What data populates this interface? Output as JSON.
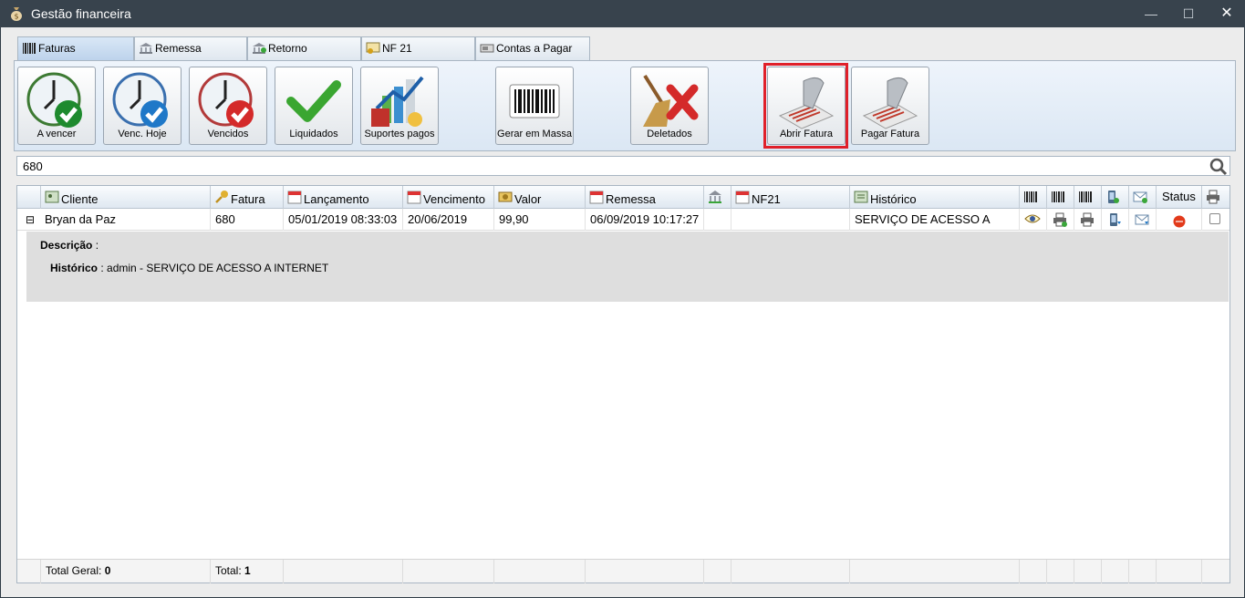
{
  "window": {
    "title": "Gestão financeira",
    "controls": {
      "minimize": "—",
      "maximize": "☐",
      "close": "✕"
    }
  },
  "tabs": [
    {
      "label": "Faturas",
      "icon": "barcode-icon",
      "active": true
    },
    {
      "label": "Remessa",
      "icon": "bank-icon"
    },
    {
      "label": "Retorno",
      "icon": "bank-return-icon"
    },
    {
      "label": "NF 21",
      "icon": "certificate-icon"
    },
    {
      "label": "Contas a Pagar",
      "icon": "bill-icon"
    }
  ],
  "toolbar": [
    {
      "label": "A vencer",
      "icon": "clock-green-check-icon"
    },
    {
      "label": "Venc. Hoje",
      "icon": "clock-blue-check-icon"
    },
    {
      "label": "Vencidos",
      "icon": "clock-red-check-icon"
    },
    {
      "label": "Liquidados",
      "icon": "green-check-icon"
    },
    {
      "label": "Suportes pagos",
      "icon": "chart-report-icon"
    },
    {
      "label": "Gerar em Massa",
      "icon": "barcode-card-icon"
    },
    {
      "label": "Deletados",
      "icon": "broom-delete-icon"
    },
    {
      "label": "Abrir Fatura",
      "icon": "barcode-scanner-icon"
    },
    {
      "label": "Pagar Fatura",
      "icon": "barcode-scanner-icon"
    }
  ],
  "search": {
    "value": "680",
    "icon": "search-icon"
  },
  "grid": {
    "columns": [
      {
        "label": "Cliente",
        "icon": "client-icon"
      },
      {
        "label": "Fatura",
        "icon": "key-icon"
      },
      {
        "label": "Lançamento",
        "icon": "calendar-icon"
      },
      {
        "label": "Vencimento",
        "icon": "calendar-icon"
      },
      {
        "label": "Valor",
        "icon": "money-icon"
      },
      {
        "label": "Remessa",
        "icon": "calendar-icon"
      },
      {
        "label": "",
        "icon": "bank-icon"
      },
      {
        "label": "NF21",
        "icon": "calendar-icon"
      },
      {
        "label": "Histórico",
        "icon": "history-icon"
      },
      {
        "label": "",
        "icon": "barcode-icon"
      },
      {
        "label": "",
        "icon": "barcode-icon"
      },
      {
        "label": "",
        "icon": "barcode-icon"
      },
      {
        "label": "",
        "icon": "phone-icon"
      },
      {
        "label": "",
        "icon": "email-icon"
      },
      {
        "label": "Status",
        "icon": ""
      },
      {
        "label": "",
        "icon": "printer-icon"
      }
    ],
    "rows": [
      {
        "expand": "⊟",
        "cliente": "Bryan da Paz",
        "fatura": "680",
        "lancamento": "05/01/2019 08:33:03",
        "vencimento": "20/06/2019",
        "valor": "99,90",
        "remessa": "06/09/2019 10:17:27",
        "banco": "",
        "nf21": "",
        "historico": "SERVIÇO DE ACESSO A",
        "actions": [
          "eye-icon",
          "print-icon",
          "print-icon",
          "phone-icon",
          "email-icon"
        ],
        "status_color": "#e23a1b",
        "checked": false
      }
    ],
    "detail": {
      "descricao_label": "Descrição",
      "descricao_value": ":",
      "historico_label": "Histórico",
      "historico_value": ": admin - SERVIÇO DE ACESSO A INTERNET"
    },
    "footer": {
      "total_geral_label": "Total Geral:",
      "total_geral_value": "0",
      "total_label": "Total:",
      "total_value": "1"
    }
  }
}
